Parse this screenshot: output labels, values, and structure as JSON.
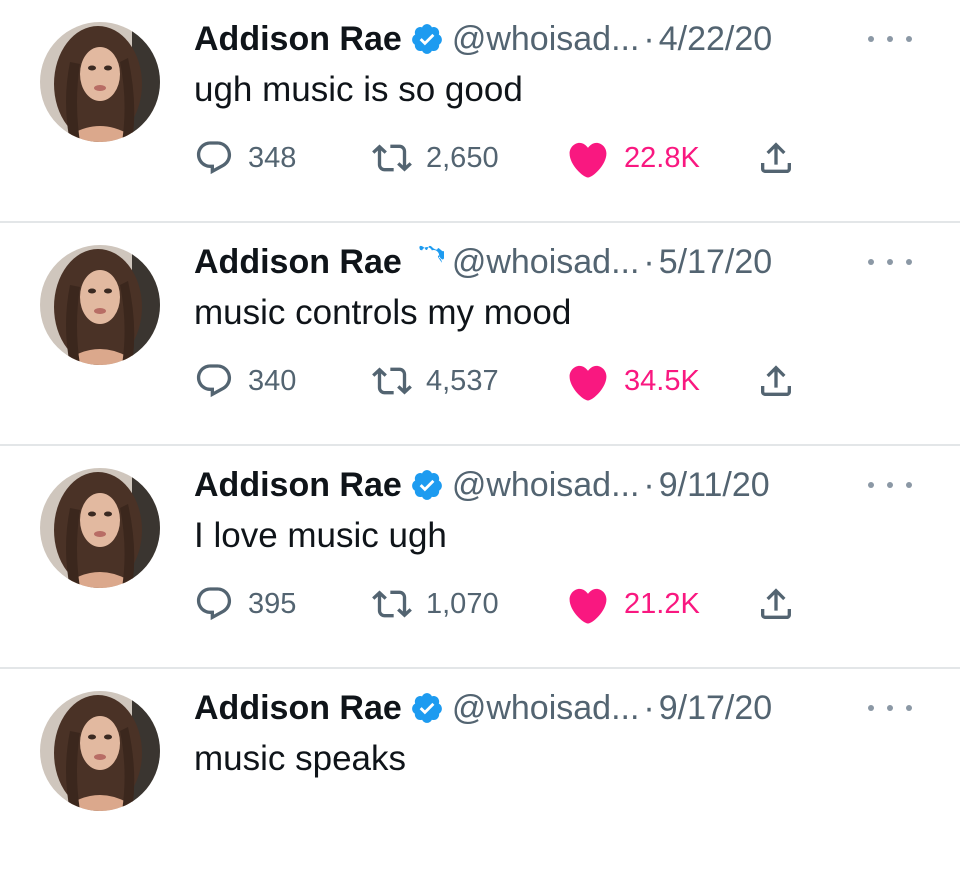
{
  "colors": {
    "name": "#0f1419",
    "secondary": "#536471",
    "verified": "#1d9bf0",
    "like": "#f91880",
    "divider": "#e3e6e8"
  },
  "icons": {
    "verified": "verified-badge-icon",
    "reply": "reply-icon",
    "retweet": "retweet-icon",
    "like": "heart-icon",
    "share": "share-icon",
    "more": "more-icon"
  },
  "tweets": [
    {
      "name": "Addison Rae",
      "handle": "@whoisad...",
      "separator": "·",
      "date": "4/22/20",
      "text": "ugh music is so good",
      "replies": "348",
      "retweets": "2,650",
      "likes": "22.8K",
      "liked": true
    },
    {
      "name": "Addison Rae",
      "handle": "@whoisad...",
      "separator": "·",
      "date": "5/17/20",
      "text": "music controls my mood",
      "replies": "340",
      "retweets": "4,537",
      "likes": "34.5K",
      "liked": true
    },
    {
      "name": "Addison Rae",
      "handle": "@whoisad...",
      "separator": "·",
      "date": "9/11/20",
      "text": "I love music ugh",
      "replies": "395",
      "retweets": "1,070",
      "likes": "21.2K",
      "liked": true
    },
    {
      "name": "Addison Rae",
      "handle": "@whoisad...",
      "separator": "·",
      "date": "9/17/20",
      "text": "music speaks"
    }
  ]
}
